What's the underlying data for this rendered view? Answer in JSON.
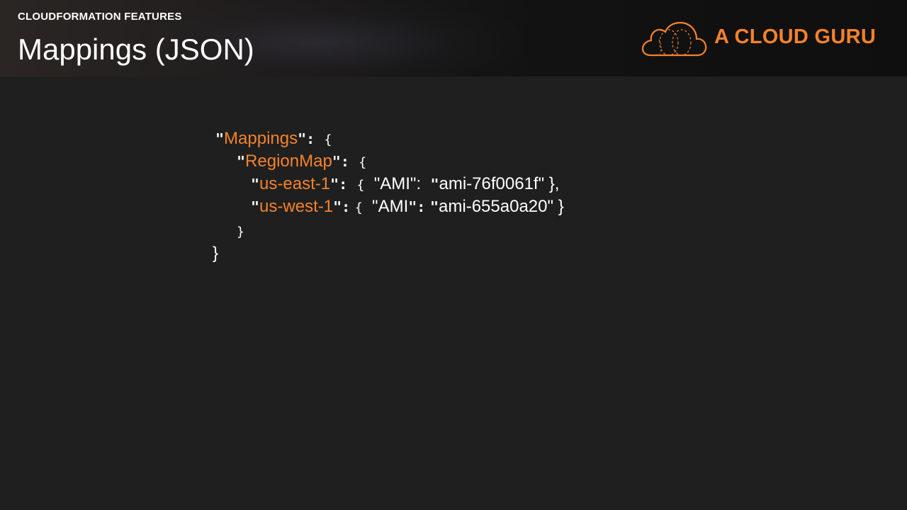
{
  "header": {
    "eyebrow": "CLOUDFORMATION FEATURES",
    "title": "Mappings (JSON)"
  },
  "logo": {
    "text": "A CLOUD GURU",
    "brand_color": "#f5822b"
  },
  "code": {
    "mappings_key": "Mappings",
    "regionmap_key": "RegionMap",
    "entries": [
      {
        "region": "us-east-1",
        "ami_key": "AMI",
        "ami_value": "ami-76f0061f",
        "trailing": "},"
      },
      {
        "region": "us-west-1",
        "ami_key": "AMI",
        "ami_value": "ami-655a0a20",
        "trailing": "}"
      }
    ],
    "open_brace": "{",
    "close_brace": "}"
  },
  "colors": {
    "background": "#1f1f1f",
    "key": "#f5822b",
    "text": "#ffffff"
  }
}
